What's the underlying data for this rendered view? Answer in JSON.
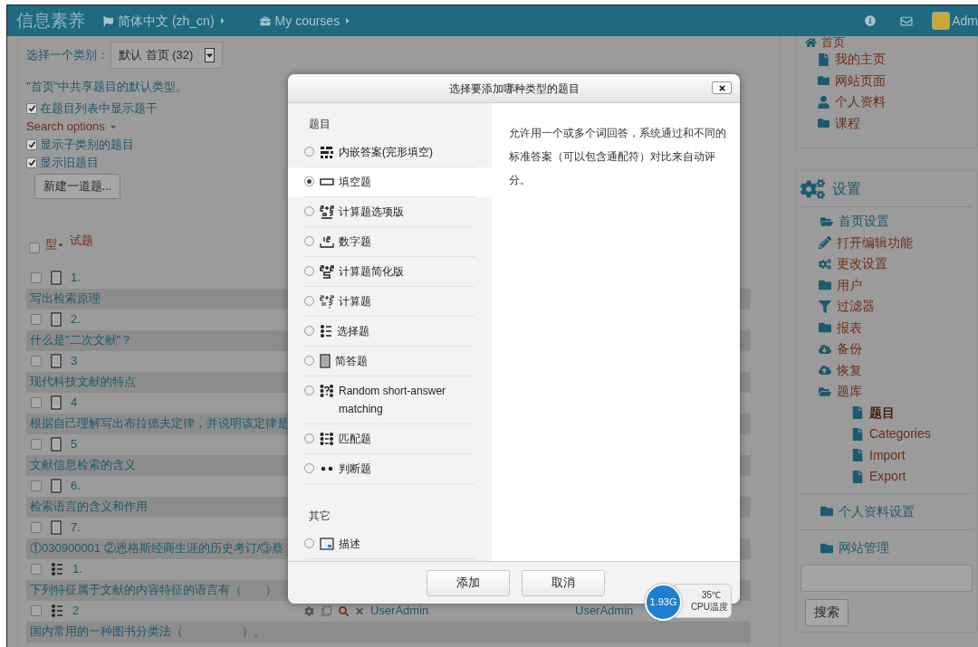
{
  "header": {
    "site_name": "信息素养",
    "language": "简体中文 (zh_cn)",
    "courses": "My courses",
    "user": "Adm"
  },
  "category": {
    "label": "选择一个类别：",
    "value": "默认 首页 (32)"
  },
  "category_note": "\"首页\"中共享题目的默认类型。",
  "options": [
    {
      "kind": "checkbox",
      "label": "在题目列表中显示题干",
      "checked": true
    },
    {
      "kind": "link",
      "label": "Search options"
    },
    {
      "kind": "checkbox",
      "label": "显示子类别的题目",
      "checked": true
    },
    {
      "kind": "checkbox",
      "label": "显示旧题目",
      "checked": true
    }
  ],
  "new_question_button": "新建一道题...",
  "table": {
    "columns": [
      "型",
      "试题"
    ],
    "all_checked": false,
    "rows": [
      {
        "kind": "essay",
        "number": "1.",
        "text": "写出检索原理",
        "checked": false
      },
      {
        "kind": "essay",
        "number": "2.",
        "text": "什么是\"二次文献\"？",
        "checked": false
      },
      {
        "kind": "essay",
        "number": "3",
        "text": "现代科技文献的特点",
        "checked": false
      },
      {
        "kind": "essay",
        "number": "4",
        "text": "根据自己理解写出布拉德夫定律，并说明该定律是",
        "checked": false
      },
      {
        "kind": "essay",
        "number": "5",
        "text": "文献信息检索的含义",
        "checked": false
      },
      {
        "kind": "essay",
        "number": "6.",
        "text": "检索语言的含义和作用",
        "checked": false
      },
      {
        "kind": "essay",
        "number": "7.",
        "text": "①030900001 ②恩格斯经商生涯的历史考订/③蔡",
        "checked": false
      },
      {
        "kind": "multichoice",
        "number": "1.",
        "text": "下列特征属于文献的内容特征的语言有（　　）",
        "checked": false
      },
      {
        "kind": "multichoice",
        "number": "2",
        "text": "国内常用的一种图书分类法（　　　　　）。",
        "checked": false,
        "created_by": "UserAdmin",
        "modified_by": "UserAdmin"
      }
    ]
  },
  "dialog": {
    "title": "选择要添加哪种类型的题目",
    "sections": [
      {
        "heading": "题目",
        "options": [
          {
            "kind": "multianswer",
            "label": "内嵌答案(完形填空)",
            "selected": false
          },
          {
            "kind": "shortanswer",
            "label": "填空题",
            "selected": true
          },
          {
            "kind": "calculatedmulti",
            "label": "计算题选项版",
            "selected": false
          },
          {
            "kind": "numerical",
            "label": "数字题",
            "selected": false
          },
          {
            "kind": "calculatedsimple",
            "label": "计算题简化版",
            "selected": false
          },
          {
            "kind": "calculated",
            "label": "计算题",
            "selected": false
          },
          {
            "kind": "multichoice",
            "label": "选择题",
            "selected": false
          },
          {
            "kind": "essay",
            "label": "简答题",
            "selected": false
          },
          {
            "kind": "randomsamatch",
            "label": "Random short-answer matching",
            "selected": false
          },
          {
            "kind": "match",
            "label": "匹配题",
            "selected": false
          },
          {
            "kind": "truefalse",
            "label": "判断题",
            "selected": false
          }
        ]
      },
      {
        "heading": "其它",
        "options": [
          {
            "kind": "description",
            "label": "描述",
            "selected": false
          }
        ]
      }
    ],
    "description": "允许用一个或多个词回答，系统通过和不同的标准答案（可以包含通配符）对比来自动评分。",
    "buttons": [
      "添加",
      "取消"
    ]
  },
  "cpu_widget": {
    "usage": "1.93G",
    "temperature": "35℃",
    "label": "CPU温度"
  },
  "navigation": {
    "home": "首页",
    "items": [
      {
        "kind": "file",
        "label": "我的主页"
      },
      {
        "kind": "folder",
        "label": "网站页面"
      },
      {
        "kind": "user",
        "label": "个人资料"
      },
      {
        "kind": "folder",
        "label": "课程"
      }
    ]
  },
  "settings": {
    "title": "设置",
    "tree": [
      {
        "kind": "folder-open",
        "label": "首页设置",
        "selected": false,
        "children": [
          {
            "kind": "pencil",
            "label": "打开编辑功能",
            "selected": false
          },
          {
            "kind": "cogs",
            "label": "更改设置",
            "selected": false
          },
          {
            "kind": "folder",
            "label": "用户",
            "selected": false
          },
          {
            "kind": "filter",
            "label": "过滤器",
            "selected": false
          },
          {
            "kind": "folder",
            "label": "报表",
            "selected": false
          },
          {
            "kind": "download",
            "label": "备份",
            "selected": false
          },
          {
            "kind": "upload",
            "label": "恢复",
            "selected": false
          },
          {
            "kind": "folder-open",
            "label": "题库",
            "selected": false,
            "children": [
              {
                "kind": "file",
                "label": "题目",
                "selected": true
              },
              {
                "kind": "file",
                "label": "Categories",
                "selected": false
              },
              {
                "kind": "file",
                "label": "Import",
                "selected": false
              },
              {
                "kind": "file",
                "label": "Export",
                "selected": false
              }
            ]
          }
        ]
      },
      {
        "kind": "folder",
        "label": "个人资料设置",
        "selected": false
      },
      {
        "kind": "folder",
        "label": "网站管理",
        "selected": false
      }
    ]
  },
  "search_button": "搜索"
}
